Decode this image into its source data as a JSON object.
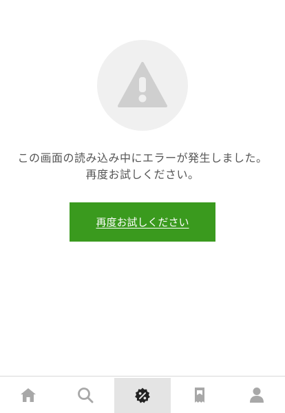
{
  "error": {
    "message": "この画面の読み込み中にエラーが発生しました。再度お試しください。",
    "retry_label": "再度お試しください",
    "icon": "warning-icon"
  },
  "tab_bar": {
    "active_index": 2,
    "items": [
      {
        "icon": "home-icon"
      },
      {
        "icon": "search-icon"
      },
      {
        "icon": "coupon-icon"
      },
      {
        "icon": "bookmark-icon"
      },
      {
        "icon": "profile-icon"
      }
    ]
  },
  "colors": {
    "accent": "#3a9a1e",
    "icon_inactive": "#a8a8a8",
    "icon_active": "#222222"
  }
}
